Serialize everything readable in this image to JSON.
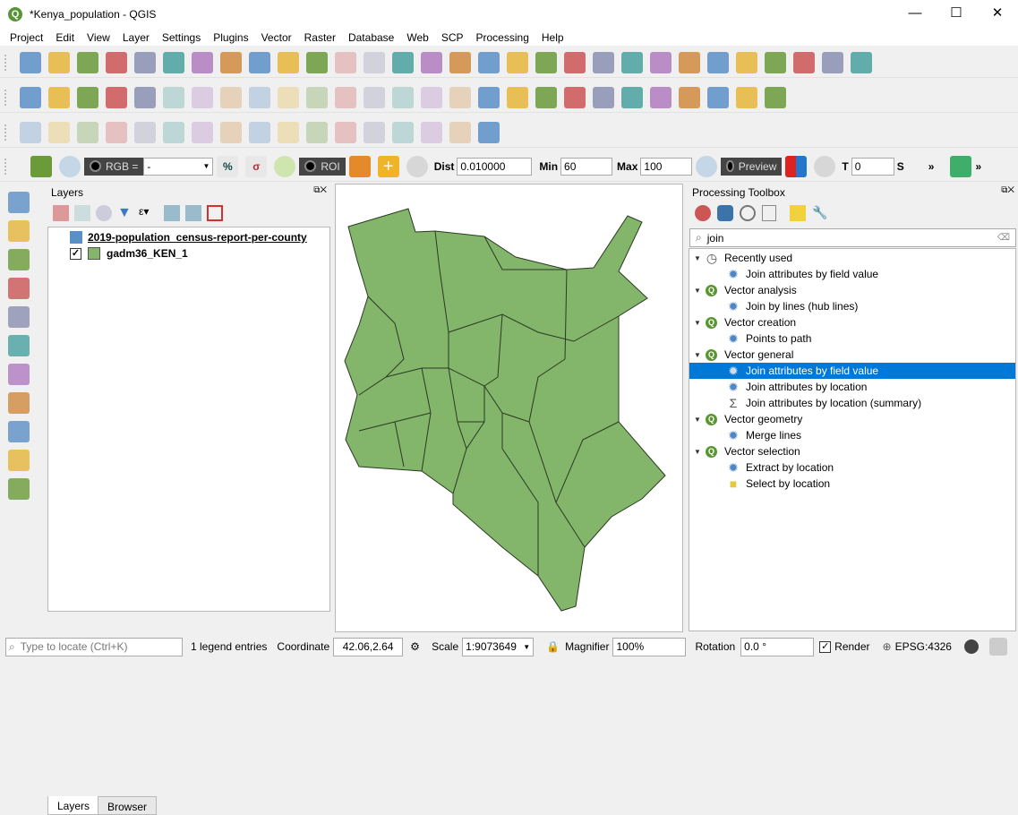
{
  "window": {
    "title": "*Kenya_population - QGIS",
    "minimize": "—",
    "maximize": "☐",
    "close": "✕"
  },
  "menu": [
    "Project",
    "Edit",
    "View",
    "Layer",
    "Settings",
    "Plugins",
    "Vector",
    "Raster",
    "Database",
    "Web",
    "SCP",
    "Processing",
    "Help"
  ],
  "toolbars": {
    "row1": [
      "new-project",
      "open-project",
      "save-project",
      "save-as",
      "print-layout",
      "layout-manager",
      "style-manager",
      "pan",
      "pan-to-selection",
      "zoom-in",
      "zoom-out",
      "zoom-native",
      "zoom-full",
      "zoom-to-selection",
      "zoom-to-layer",
      "zoom-last",
      "zoom-next",
      "new-bookmark",
      "show-bookmarks",
      "spatial-bookmark",
      "refresh",
      "identify",
      "select-by-area",
      "select-by-value",
      "deselect",
      "attribute-table",
      "field-calculator",
      "processing-toolbox",
      "statistics",
      "measure"
    ],
    "row2": [
      "data-source-manager",
      "add-vector-layer",
      "new-shapefile",
      "digitize",
      "add-raster",
      "current-edits",
      "toggle-editing",
      "save-edits",
      "add-feature",
      "vertex-tool",
      "delete-selected",
      "cut",
      "copy",
      "paste",
      "undo",
      "redo",
      "scp-dock",
      "label",
      "label-pin",
      "label-highlight",
      "label-show",
      "label-move",
      "label-rotate",
      "label-change",
      "label-style",
      "python",
      "help"
    ],
    "row3": [
      "advanced-digitize",
      "rotate",
      "simplify",
      "add-ring",
      "add-part",
      "fill-ring",
      "delete-ring",
      "delete-part",
      "reshape",
      "offset-curve",
      "split-features",
      "split-parts",
      "merge-attributes",
      "merge-selected",
      "rotate-point",
      "measure-angle",
      "georeferencer"
    ],
    "scp": {
      "rgb_label": "RGB =",
      "rgb_value": "-",
      "roi_label": "ROI",
      "dist_label": "Dist",
      "dist_value": "0.010000",
      "min_label": "Min",
      "min_value": "60",
      "max_label": "Max",
      "max_value": "100",
      "preview_label": "Preview",
      "t_label": "T",
      "t_value": "0",
      "s_label": "S"
    }
  },
  "left_toolbar": [
    "add-vector-layer",
    "add-raster-layer",
    "add-mesh-layer",
    "add-delimited-text",
    "add-spatialite",
    "add-postgis",
    "add-wms",
    "add-wcs",
    "add-wfs",
    "add-virtual-layer",
    "new-table"
  ],
  "layers_panel": {
    "title": "Layers",
    "layers": [
      {
        "name": "2019-population_census-report-per-county",
        "type": "table",
        "checked": null
      },
      {
        "name": "gadm36_KEN_1",
        "type": "polygon",
        "checked": true,
        "color": "#83b56b"
      }
    ],
    "tabs": [
      "Layers",
      "Browser"
    ]
  },
  "map": {
    "fill": "#83b56b",
    "stroke": "#2a3a22"
  },
  "processing": {
    "title": "Processing Toolbox",
    "search": "join",
    "groups": [
      {
        "name": "Recently used",
        "icon": "clock",
        "items": [
          {
            "name": "Join attributes by field value",
            "icon": "gear"
          }
        ]
      },
      {
        "name": "Vector analysis",
        "icon": "qgis",
        "items": [
          {
            "name": "Join by lines (hub lines)",
            "icon": "gear"
          }
        ]
      },
      {
        "name": "Vector creation",
        "icon": "qgis",
        "items": [
          {
            "name": "Points to path",
            "icon": "gear"
          }
        ]
      },
      {
        "name": "Vector general",
        "icon": "qgis",
        "items": [
          {
            "name": "Join attributes by field value",
            "icon": "gear",
            "selected": true
          },
          {
            "name": "Join attributes by location",
            "icon": "gear"
          },
          {
            "name": "Join attributes by location (summary)",
            "icon": "sigma"
          }
        ]
      },
      {
        "name": "Vector geometry",
        "icon": "qgis",
        "items": [
          {
            "name": "Merge lines",
            "icon": "gear"
          }
        ]
      },
      {
        "name": "Vector selection",
        "icon": "qgis",
        "items": [
          {
            "name": "Extract by location",
            "icon": "gear"
          },
          {
            "name": "Select by location",
            "icon": "select"
          }
        ]
      }
    ]
  },
  "status": {
    "locate_placeholder": "Type to locate (Ctrl+K)",
    "legend": "1 legend entries",
    "coord_label": "Coordinate",
    "coord": "42.06,2.64",
    "scale_label": "Scale",
    "scale": "1:9073649",
    "magnifier_label": "Magnifier",
    "magnifier": "100%",
    "rotation_label": "Rotation",
    "rotation": "0.0 °",
    "render_label": "Render",
    "render_checked": true,
    "crs": "EPSG:4326"
  },
  "colors": {
    "accent": "#0078d7",
    "qgis_green": "#589632"
  }
}
